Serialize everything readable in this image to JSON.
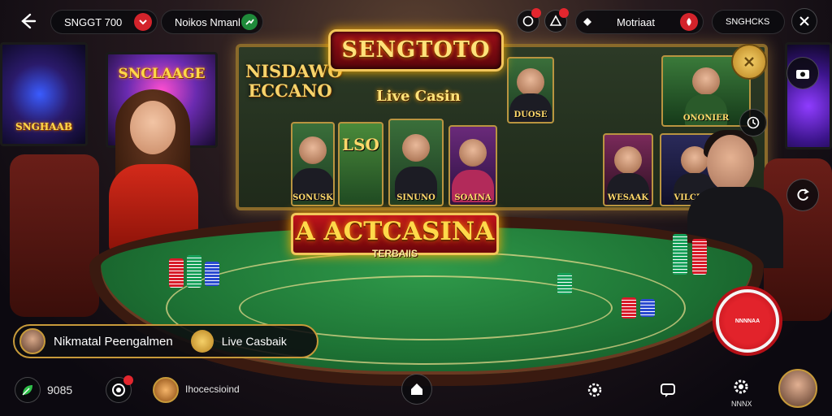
{
  "topbar": {
    "left_pill_label": "SNGGT 700",
    "mid_pill_label": "Noikos Nmanl",
    "right_pill_label": "Motriaat",
    "far_right_pill_label": "SNGHCKS"
  },
  "venue": {
    "main_sign": "SENGTOTO",
    "main_sign_sub": "Live Casin",
    "table_sign": "A ACTCASINA",
    "table_sign_sub": "TERBAIIS",
    "board_left_title": "NISDAWO ECCANO",
    "screen_left_caption": "SNGHAAB",
    "screen_left2_caption": "SNCLAAGE",
    "tiles": [
      {
        "caption": "SONUSK"
      },
      {
        "caption": "LSO"
      },
      {
        "caption": "SINUNO"
      },
      {
        "caption": "SOAINA"
      },
      {
        "caption": "DUOSE"
      },
      {
        "caption": "WESAAK"
      },
      {
        "caption": "ONONIER"
      },
      {
        "caption": "VILCEAR"
      }
    ]
  },
  "info_bar": {
    "user_name": "Nikmatal Peengalmen",
    "status_label": "Live Casbaik"
  },
  "bottombar": {
    "balance": "9085",
    "game_label": "Ihocecsioind",
    "settings_caption": "NNNX"
  },
  "record_button_label": "NNNNAA",
  "colors": {
    "accent_gold": "#f2c65a",
    "accent_red": "#d81b2a",
    "felt_green": "#1e7435"
  }
}
